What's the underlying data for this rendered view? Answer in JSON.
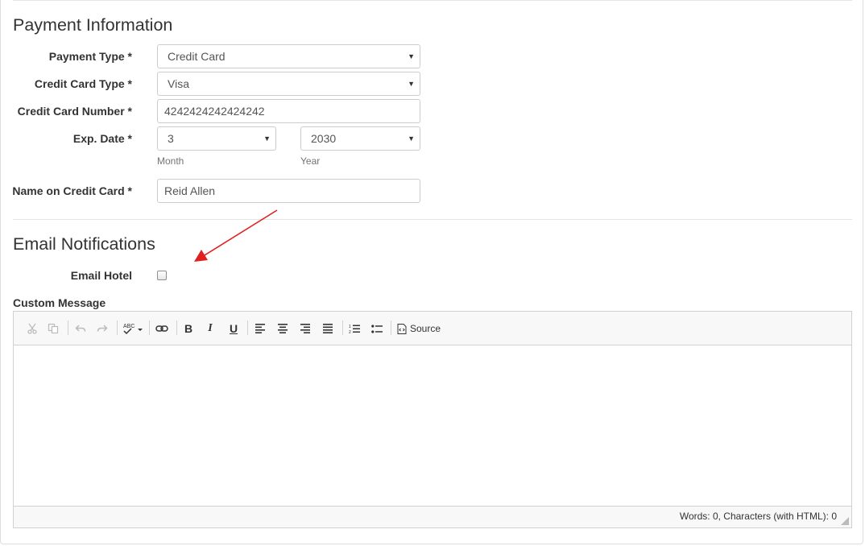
{
  "payment": {
    "title": "Payment Information",
    "payment_type": {
      "label": "Payment Type *",
      "value": "Credit Card"
    },
    "card_type": {
      "label": "Credit Card Type *",
      "value": "Visa"
    },
    "card_number": {
      "label": "Credit Card Number *",
      "value": "4242424242424242"
    },
    "exp_date": {
      "label": "Exp. Date *",
      "month": "3",
      "month_help": "Month",
      "year": "2030",
      "year_help": "Year"
    },
    "name_on_card": {
      "label": "Name on Credit Card *",
      "value": "Reid Allen"
    }
  },
  "email": {
    "title": "Email Notifications",
    "email_hotel_label": "Email Hotel",
    "email_hotel_checked": false,
    "custom_message_label": "Custom Message"
  },
  "editor": {
    "toolbar": [
      "cut-icon",
      "copy-icon",
      "undo-icon",
      "redo-icon",
      "spellcheck-icon",
      "link-icon",
      "bold-icon",
      "italic-icon",
      "underline-icon",
      "align-left-icon",
      "align-center-icon",
      "align-right-icon",
      "justify-icon",
      "numbered-list-icon",
      "bulleted-list-icon",
      "source-icon"
    ],
    "source_label": "Source",
    "word_count": "Words: 0, Characters (with HTML): 0"
  },
  "colors": {
    "annotation_arrow": "#e02020"
  }
}
